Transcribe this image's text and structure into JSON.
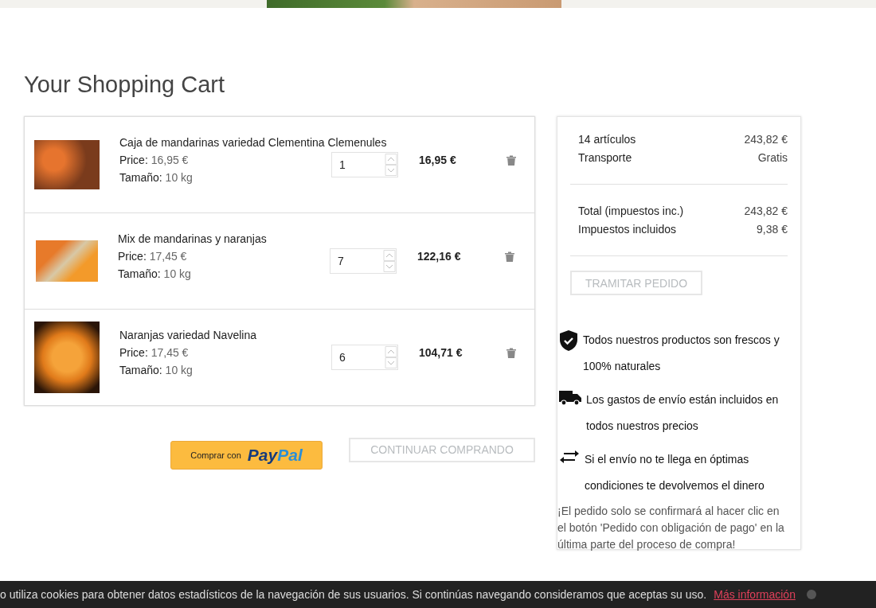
{
  "title": "Your Shopping Cart",
  "cart_items": [
    {
      "name": "Caja de mandarinas variedad Clementina Clemenules",
      "price_label": "Price:",
      "price": "16,95 €",
      "size_label": "Tamaño:",
      "size": "10 kg",
      "quantity": "1",
      "total": "16,95 €"
    },
    {
      "name": "Mix de mandarinas y naranjas",
      "price_label": "Price:",
      "price": "17,45 €",
      "size_label": "Tamaño:",
      "size": "10 kg",
      "quantity": "7",
      "total": "122,16 €"
    },
    {
      "name": "Naranjas variedad Navelina",
      "price_label": "Price:",
      "price": "17,45 €",
      "size_label": "Tamaño:",
      "size": "10 kg",
      "quantity": "6",
      "total": "104,71 €"
    }
  ],
  "paypal_button": {
    "label": "Comprar con",
    "logo_first": "Pay",
    "logo_second": "Pal"
  },
  "continue_button": {
    "label": "CONTINUAR COMPRANDO",
    "disabled": true
  },
  "summary": {
    "groups": [
      [
        {
          "label": "14 artículos",
          "value": "243,82 €"
        },
        {
          "label": "Transporte",
          "value": "Gratis"
        }
      ],
      [
        {
          "label": "Total (impuestos inc.)",
          "value": "243,82 €"
        },
        {
          "label": "Impuestos incluidos",
          "value": "9,38 €"
        }
      ]
    ],
    "checkout_button": {
      "label": "TRAMITAR PEDIDO",
      "disabled": true
    },
    "features": [
      {
        "kind": "shield",
        "text": "Todos nuestros productos son frescos y 100% naturales"
      },
      {
        "kind": "truck",
        "text": "Los gastos de envío están incluidos en todos nuestros precios"
      },
      {
        "kind": "exchange",
        "text": "Si el envío no te llega en óptimas condiciones te devolvemos el dinero"
      }
    ],
    "note": "¡El pedido solo se confirmará al hacer clic en el botón 'Pedido con obligación de pago' en la última parte del proceso de compra!"
  },
  "cookie_bar": {
    "text": "o utiliza cookies para obtener datos estadísticos de la navegación de sus usuarios. Si continúas navegando consideramos que aceptas su uso.",
    "link": "Más información"
  }
}
